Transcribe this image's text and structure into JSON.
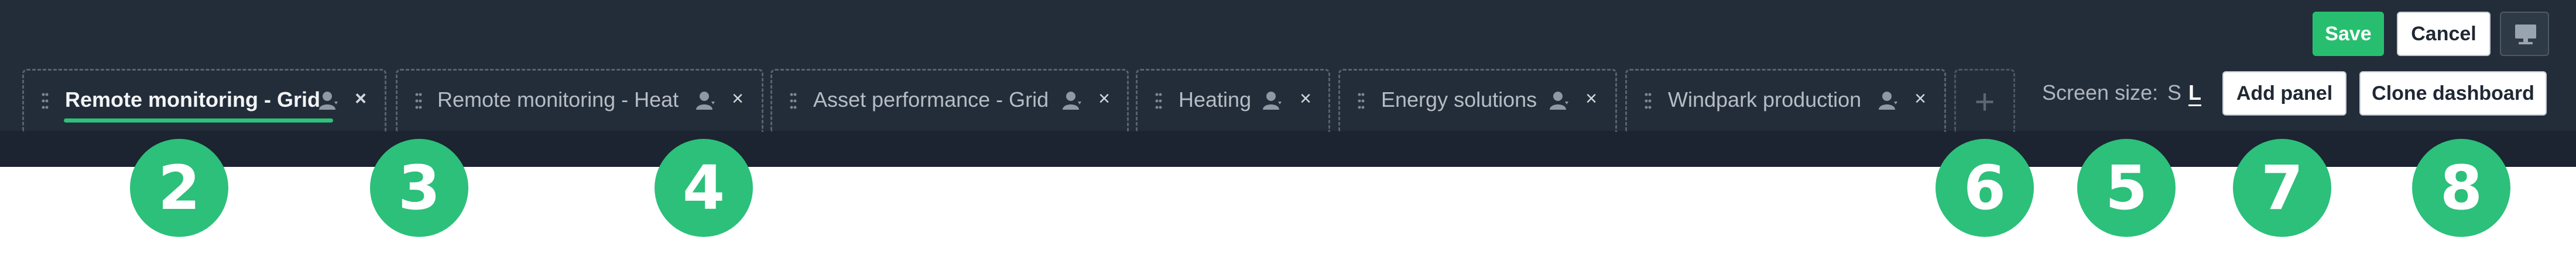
{
  "header": {
    "save_label": "Save",
    "cancel_label": "Cancel",
    "panel_icon": "monitor-icon"
  },
  "tabs": [
    {
      "label": "Remote monitoring - Grid",
      "active": true,
      "icons": [
        "drag-handle-icon",
        "person-icon",
        "close-icon"
      ]
    },
    {
      "label": "Remote monitoring - Heat",
      "active": false,
      "icons": [
        "drag-handle-icon",
        "person-icon",
        "close-icon"
      ]
    },
    {
      "label": "Asset performance - Grid",
      "active": false,
      "icons": [
        "drag-handle-icon",
        "person-icon",
        "close-icon"
      ]
    },
    {
      "label": "Heating",
      "active": false,
      "icons": [
        "drag-handle-icon",
        "person-icon",
        "close-icon"
      ]
    },
    {
      "label": "Energy solutions",
      "active": false,
      "icons": [
        "drag-handle-icon",
        "person-icon",
        "close-icon"
      ]
    },
    {
      "label": "Windpark production",
      "active": false,
      "icons": [
        "drag-handle-icon",
        "person-icon",
        "close-icon"
      ]
    }
  ],
  "close_glyph": "×",
  "add_tab_glyph": "+",
  "screen_size": {
    "label": "Screen size:",
    "options": [
      "S",
      "L"
    ],
    "selected": "L"
  },
  "actions": {
    "add_panel_label": "Add panel",
    "clone_dashboard_label": "Clone dashboard"
  },
  "callouts": [
    "2",
    "3",
    "4",
    "6",
    "5",
    "7",
    "8"
  ],
  "colors": {
    "toolbar_bg": "#232d3a",
    "accent_green": "#27bf6f",
    "badge_green": "#2cc07a"
  }
}
